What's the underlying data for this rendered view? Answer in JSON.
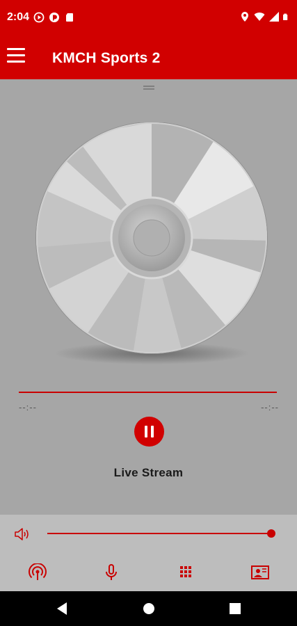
{
  "status_bar": {
    "time": "2:04",
    "left_icons": [
      "media-play-icon",
      "pocket-casts-icon",
      "sd-card-icon"
    ],
    "right_icons": [
      "location-icon",
      "wifi-icon",
      "signal-icon",
      "battery-icon"
    ]
  },
  "app_bar": {
    "menu_icon": "hamburger-menu-icon",
    "title": "KMCH Sports 2"
  },
  "player": {
    "artwork": "cd-disc-icon",
    "elapsed": "--:--",
    "duration": "--:--",
    "progress": 1.0,
    "play_state_icon": "pause-icon",
    "track_title": "Live Stream"
  },
  "volume": {
    "icon": "volume-speaker-icon",
    "level": 1.0
  },
  "nav_items": [
    {
      "name": "podcast-icon"
    },
    {
      "name": "microphone-icon"
    },
    {
      "name": "grid-apps-icon"
    },
    {
      "name": "contact-card-icon"
    }
  ],
  "android_nav": [
    "back-icon",
    "home-icon",
    "recents-icon"
  ],
  "colors": {
    "accent": "#d10000",
    "background": "#a6a6a6",
    "controls_background": "#bdbdbd",
    "system_nav": "#000000"
  }
}
